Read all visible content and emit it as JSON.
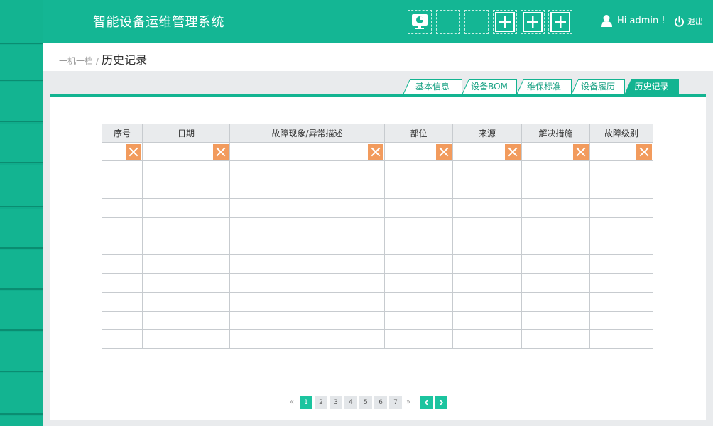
{
  "app": {
    "title": "智能设备运维管理系统"
  },
  "header": {
    "user_greeting": "Hi admin !",
    "logout_label": "退出",
    "toolbar_icons": [
      "monitor-chart-icon",
      "empty-slot",
      "empty-slot",
      "plus-icon",
      "plus-icon",
      "plus-icon"
    ]
  },
  "breadcrumb": {
    "parent": "一机一档",
    "separator": "/",
    "current": "历史记录"
  },
  "tabs": [
    {
      "label": "基本信息",
      "active": false
    },
    {
      "label": "设备BOM",
      "active": false
    },
    {
      "label": "维保标准",
      "active": false
    },
    {
      "label": "设备履历",
      "active": false
    },
    {
      "label": "历史记录",
      "active": true
    }
  ],
  "table": {
    "columns": [
      "序号",
      "日期",
      "故障现象/异常描述",
      "部位",
      "来源",
      "解决措施",
      "故障级别"
    ],
    "filter_clear_icon": "close-icon",
    "empty_rows": 10
  },
  "pagination": {
    "prev_symbol": "«",
    "next_symbol": "»",
    "pages": [
      "1",
      "2",
      "3",
      "4",
      "5",
      "6",
      "7"
    ],
    "current_page": "1"
  },
  "colors": {
    "primary": "#14b694",
    "sidebar": "#10ad8c",
    "clear_button": "#f29b5d",
    "page_active": "#1cc49f"
  }
}
